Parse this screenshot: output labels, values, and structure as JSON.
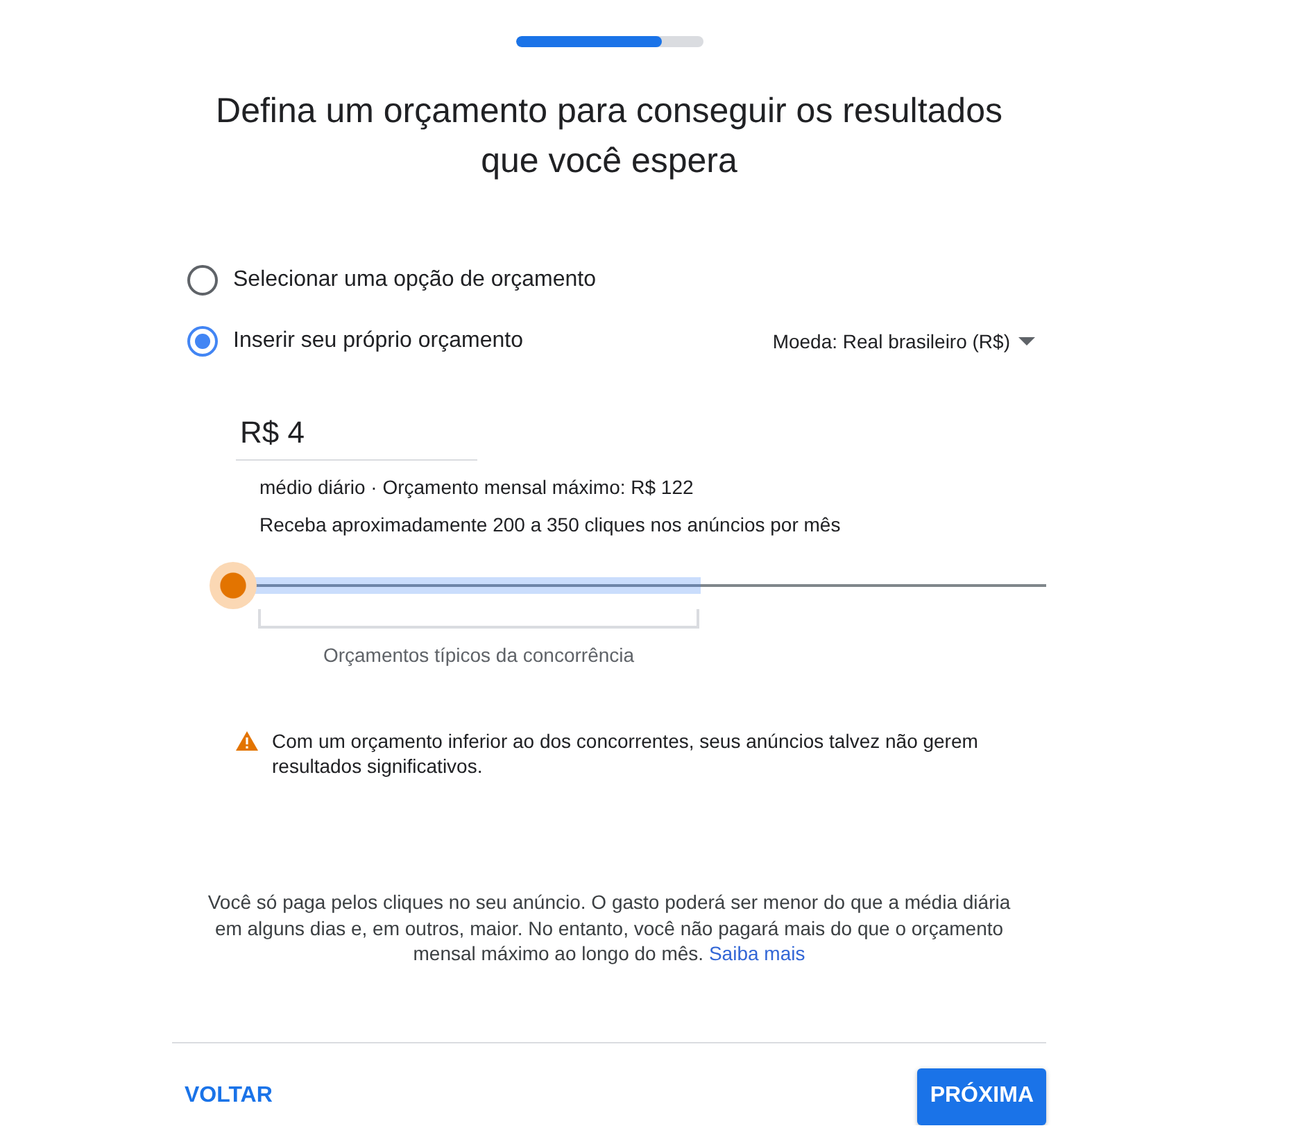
{
  "progress": {
    "level": 0.78
  },
  "title": "Defina um orçamento para conseguir os resultados que você espera",
  "budget_options": [
    {
      "label": "Selecionar uma opção de orçamento",
      "selected": false
    },
    {
      "label": "Inserir seu próprio orçamento",
      "selected": true
    }
  ],
  "currency_dropdown": {
    "label": "Moeda: Real brasileiro (R$)"
  },
  "budget_input": {
    "value": "R$ 4"
  },
  "summary": "médio diário · Orçamento mensal máximo: R$ 122",
  "estimate": "Receba aproximadamente 200 a 350 cliques nos anúncios por mês",
  "slider": {
    "level": 0,
    "range_label": "Orçamentos típicos da concorrência"
  },
  "warning": "Com um orçamento inferior ao dos concorrentes, seus anúncios talvez não gerem resultados significativos.",
  "info": {
    "text": "Você só paga pelos cliques no seu anúncio. O gasto poderá ser menor do que a média diária em alguns dias e, em outros, maior. No entanto, você não pagará mais do que o orçamento mensal máximo ao longo do mês.",
    "link": "Saiba mais"
  },
  "buttons": {
    "back": "VOLTAR",
    "next": "PRÓXIMA"
  }
}
